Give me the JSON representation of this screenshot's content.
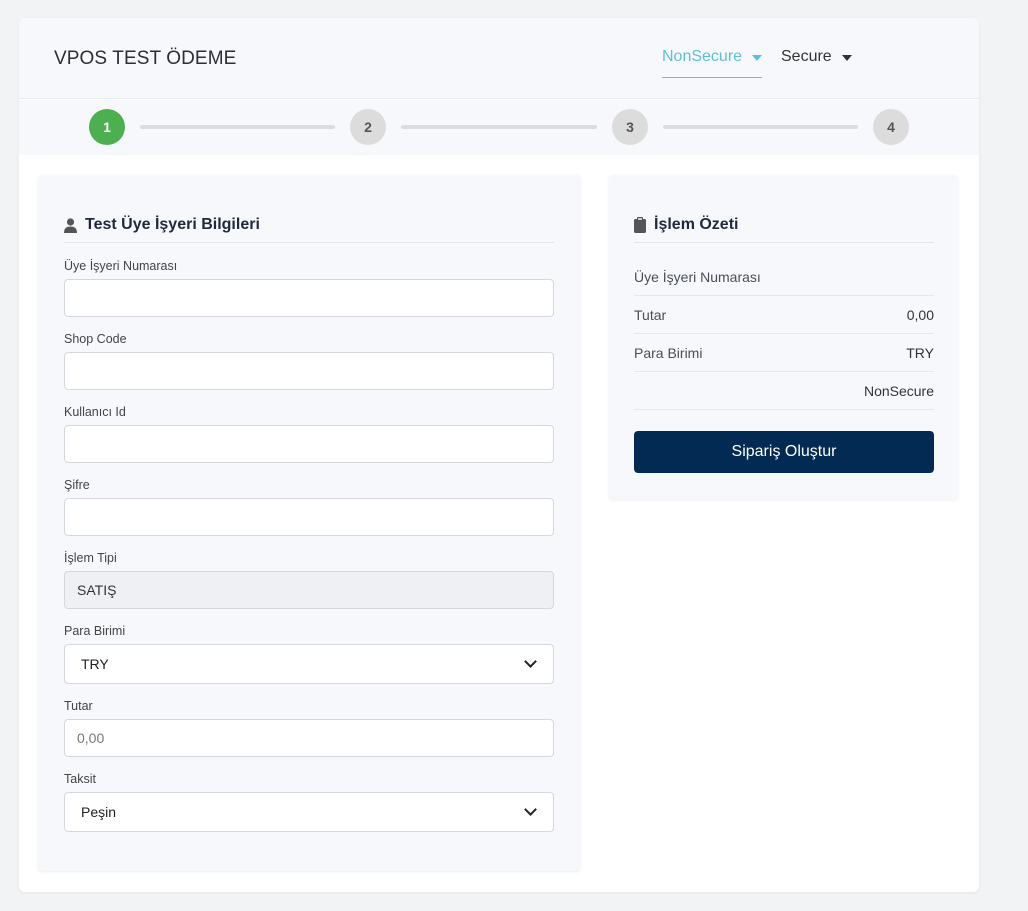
{
  "header": {
    "title": "VPOS TEST ÖDEME",
    "tabs": [
      {
        "label": "NonSecure",
        "active": true
      },
      {
        "label": "Secure",
        "active": false
      }
    ]
  },
  "stepper": {
    "steps": [
      "1",
      "2",
      "3",
      "4"
    ],
    "current": 1
  },
  "form": {
    "heading": "Test Üye İşyeri Bilgileri",
    "merchant_no": {
      "label": "Üye İşyeri Numarası",
      "value": ""
    },
    "shop_code": {
      "label": "Shop Code",
      "value": ""
    },
    "user_id": {
      "label": "Kullanıcı Id",
      "value": ""
    },
    "password": {
      "label": "Şifre",
      "value": ""
    },
    "transaction_type": {
      "label": "İşlem Tipi",
      "value": "SATIŞ"
    },
    "currency": {
      "label": "Para Birimi",
      "selected": "TRY"
    },
    "amount": {
      "label": "Tutar",
      "placeholder": "0,00",
      "value": ""
    },
    "installment": {
      "label": "Taksit",
      "selected": "Peşin"
    }
  },
  "summary": {
    "heading": "İşlem Özeti",
    "rows": [
      {
        "label": "Üye İşyeri Numarası",
        "value": ""
      },
      {
        "label": "Tutar",
        "value": "0,00"
      },
      {
        "label": "Para Birimi",
        "value": "TRY"
      },
      {
        "label": "",
        "value": "NonSecure"
      }
    ],
    "button": "Sipariş Oluştur"
  },
  "colors": {
    "accent": "#5bc0de",
    "step_done": "#4caf50",
    "button_bg": "#022a52"
  }
}
